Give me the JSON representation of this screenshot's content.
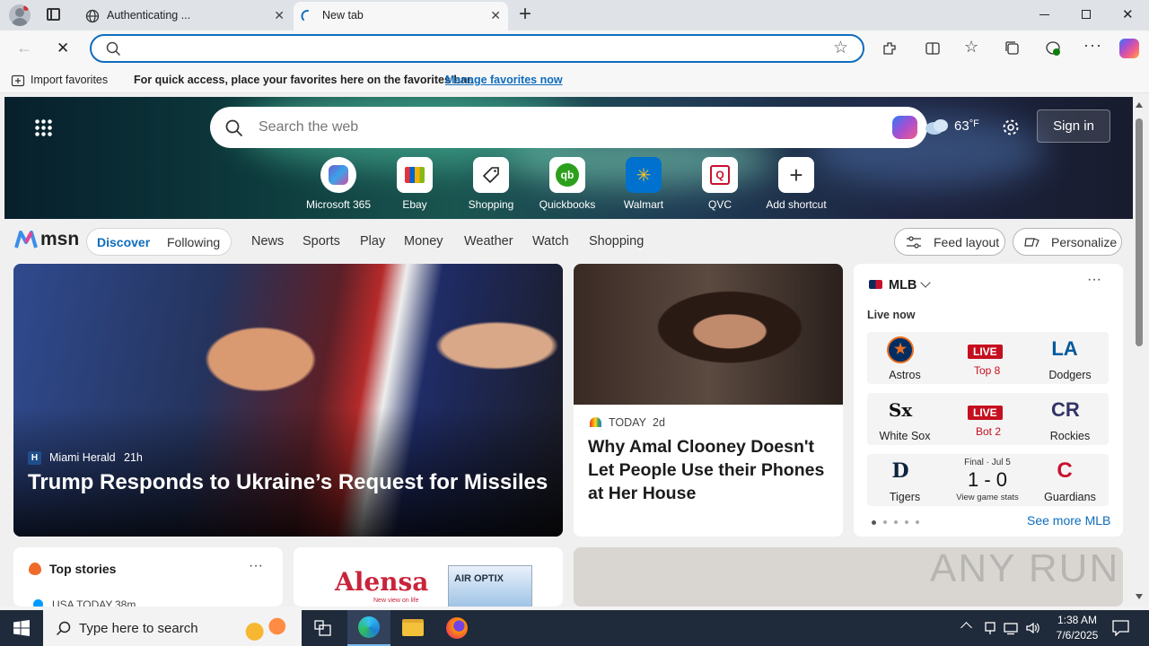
{
  "browser": {
    "tabs": [
      {
        "title": "Authenticating ..."
      },
      {
        "title": "New tab"
      }
    ],
    "new_tab_symbol": "+",
    "window_controls": [
      "minimize",
      "restore",
      "close"
    ],
    "address": {
      "value": "",
      "placeholder": ""
    },
    "favorites_bar": {
      "import_label": "Import favorites",
      "message": "For quick access, place your favorites here on the favorites bar.",
      "manage_link": "Manage favorites now"
    }
  },
  "hero": {
    "search_placeholder": "Search the web",
    "weather_temp": "63",
    "weather_unit": "°F",
    "sign_in": "Sign in",
    "shortcuts": [
      {
        "label": "Microsoft 365"
      },
      {
        "label": "Ebay"
      },
      {
        "label": "Shopping"
      },
      {
        "label": "Quickbooks"
      },
      {
        "label": "Walmart"
      },
      {
        "label": "QVC"
      },
      {
        "label": "Add shortcut"
      }
    ]
  },
  "msn": {
    "logo": "msn",
    "tabs": [
      "Discover",
      "Following"
    ],
    "nav": [
      "News",
      "Sports",
      "Play",
      "Money",
      "Weather",
      "Watch",
      "Shopping"
    ],
    "feed_layout": "Feed layout",
    "personalize": "Personalize"
  },
  "cards": {
    "main": {
      "source": "Miami Herald",
      "age": "21h",
      "headline": "Trump Responds to Ukraine’s Request for Missiles"
    },
    "secondary": {
      "source": "TODAY",
      "age": "2d",
      "headline": "Why Amal Clooney Doesn't Let People Use their Phones at Her House"
    },
    "mlb": {
      "title": "MLB",
      "live_now": "Live now",
      "games": [
        {
          "home": "Astros",
          "away": "Dodgers",
          "status": "LIVE",
          "detail": "Top 8"
        },
        {
          "home": "White Sox",
          "away": "Rockies",
          "status": "LIVE",
          "detail": "Bot 2"
        },
        {
          "home": "Tigers",
          "away": "Guardians",
          "status": "Final · Jul 5",
          "score": "1 - 0",
          "detail": "View game stats"
        }
      ],
      "see_more": "See more MLB"
    },
    "top_stories": {
      "title": "Top stories",
      "source": "USA TODAY",
      "age": "38m"
    },
    "ad": {
      "brand": "Alensa",
      "tagline": "New view on life",
      "product": "AIR OPTIX"
    }
  },
  "watermark": "ANY RUN",
  "taskbar": {
    "search_placeholder": "Type here to search",
    "time": "1:38 AM",
    "date": "7/6/2025"
  },
  "colors": {
    "accent": "#0f6cbd",
    "live_red": "#c50f1f",
    "taskbar": "#1f2a3a"
  }
}
